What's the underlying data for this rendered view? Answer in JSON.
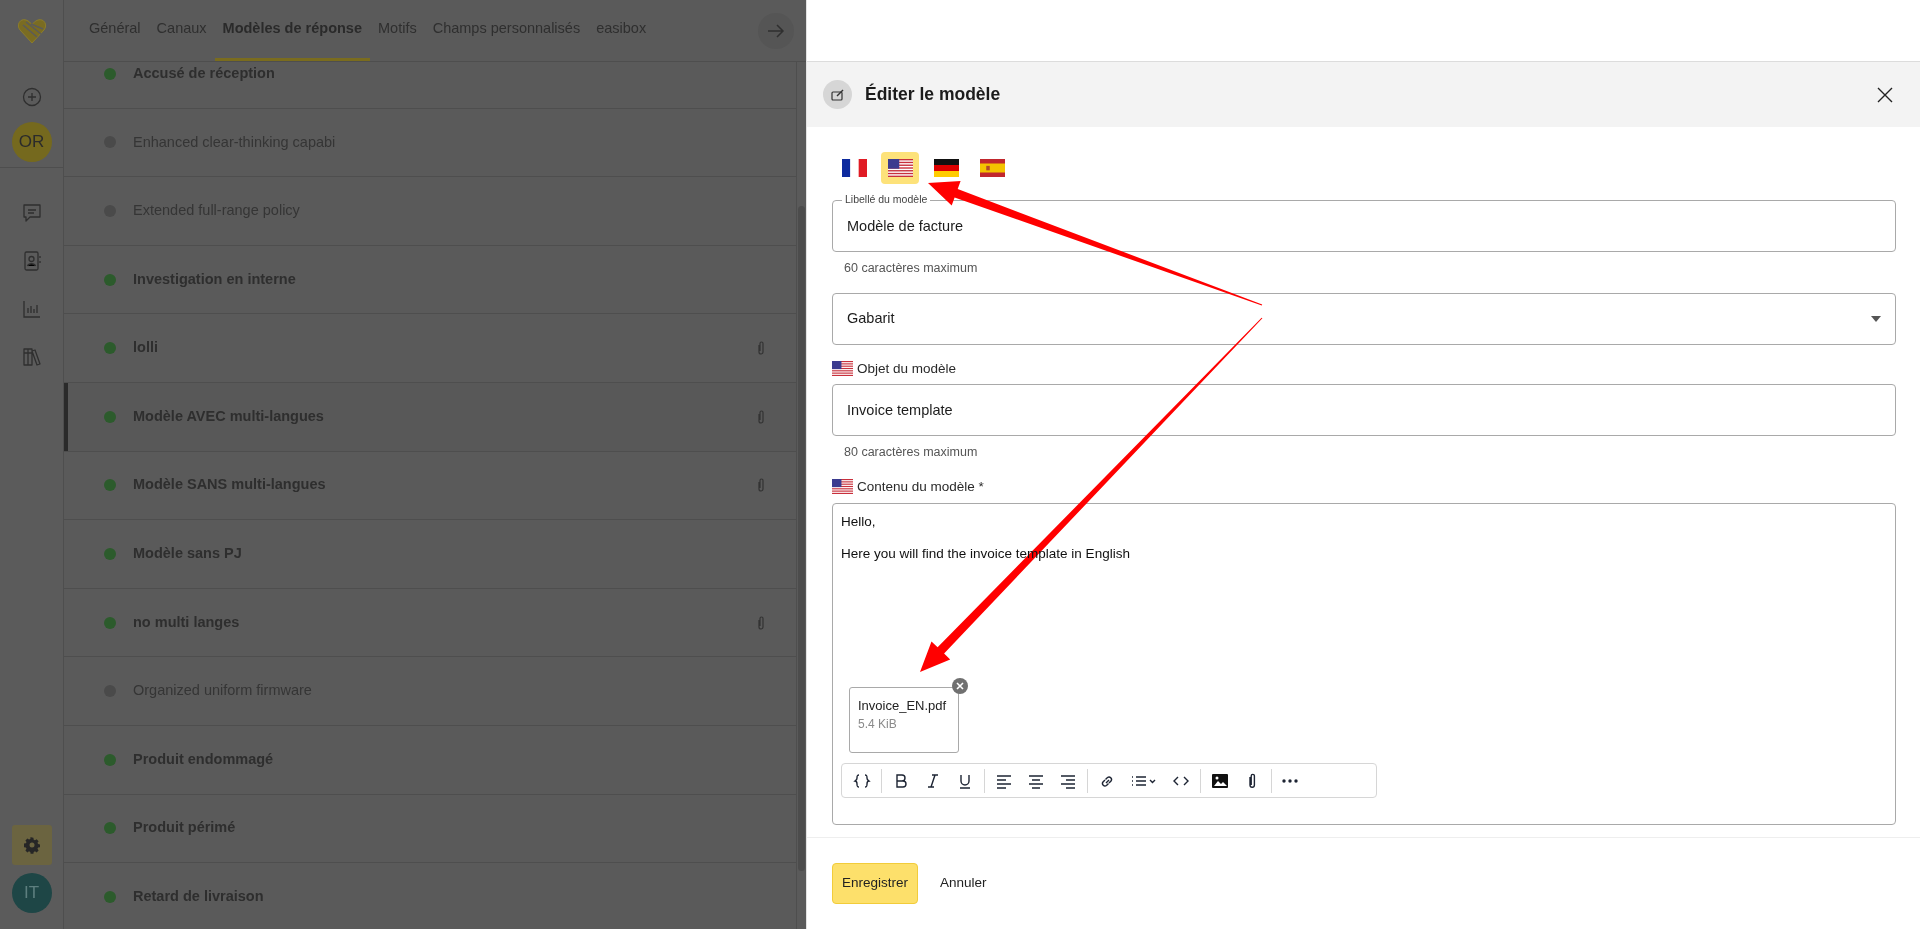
{
  "nav": {
    "user_avatar": "OR",
    "settings": {
      "selected": true
    },
    "account_avatar": "IT"
  },
  "tabs": [
    {
      "label": "Général",
      "selected": false
    },
    {
      "label": "Canaux",
      "selected": false
    },
    {
      "label": "Modèles de réponse",
      "selected": true
    },
    {
      "label": "Motifs",
      "selected": false
    },
    {
      "label": "Champs personnalisés",
      "selected": false
    },
    {
      "label": "easibox",
      "selected": false
    }
  ],
  "templates": [
    {
      "name": "Accusé de réception",
      "active": true,
      "attachment": false,
      "selected": false
    },
    {
      "name": "Enhanced clear-thinking capabi",
      "active": false,
      "attachment": false,
      "selected": false
    },
    {
      "name": "Extended full-range policy",
      "active": false,
      "attachment": false,
      "selected": false
    },
    {
      "name": "Investigation en interne",
      "active": true,
      "attachment": false,
      "selected": false
    },
    {
      "name": "lolli",
      "active": true,
      "attachment": true,
      "selected": false
    },
    {
      "name": "Modèle AVEC multi-langues",
      "active": true,
      "attachment": true,
      "selected": true
    },
    {
      "name": "Modèle SANS multi-langues",
      "active": true,
      "attachment": true,
      "selected": false
    },
    {
      "name": "Modèle sans PJ",
      "active": true,
      "attachment": false,
      "selected": false
    },
    {
      "name": "no multi langes",
      "active": true,
      "attachment": true,
      "selected": false
    },
    {
      "name": "Organized uniform firmware",
      "active": false,
      "attachment": false,
      "selected": false
    },
    {
      "name": "Produit endommagé",
      "active": true,
      "attachment": false,
      "selected": false
    },
    {
      "name": "Produit périmé",
      "active": true,
      "attachment": false,
      "selected": false
    },
    {
      "name": "Retard de livraison",
      "active": true,
      "attachment": false,
      "selected": false
    }
  ],
  "dialog": {
    "title": "Éditer le modèle",
    "languages": [
      {
        "kind": "fr",
        "selected": false
      },
      {
        "kind": "us",
        "selected": true
      },
      {
        "kind": "de",
        "selected": false
      },
      {
        "kind": "es",
        "selected": false
      }
    ],
    "label_field": {
      "label": "Libellé du modèle",
      "value": "Modèle de facture",
      "hint": "60 caractères maximum"
    },
    "template_select": {
      "label": "Gabarit"
    },
    "subject_field": {
      "label": "Objet du modèle",
      "value": "Invoice template",
      "hint": "80 caractères maximum"
    },
    "content": {
      "label": "Contenu du modèle *",
      "lines": [
        "Hello,",
        "Here you will find the invoice template in English"
      ],
      "attachments": [
        {
          "name": "Invoice_EN.pdf",
          "size": "5.4 KiB"
        }
      ]
    },
    "buttons": [
      {
        "label": "Enregistrer",
        "kind": "primary"
      },
      {
        "label": "Annuler",
        "kind": "plain"
      }
    ]
  }
}
